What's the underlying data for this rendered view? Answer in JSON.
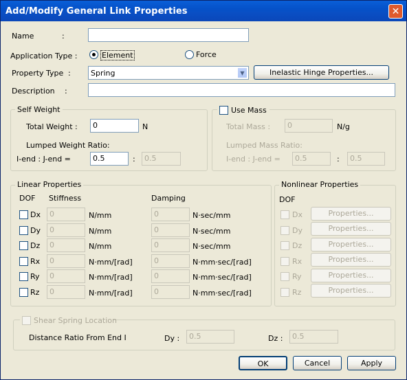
{
  "window": {
    "title": "Add/Modify General Link Properties",
    "close_label": "✕"
  },
  "general": {
    "name_label": "Name",
    "colon": ":",
    "name_value": "",
    "app_type_label": "Application Type :",
    "app_type_element": "Element",
    "app_type_force": "Force",
    "prop_type_label": "Property Type",
    "prop_type_value": "Spring",
    "inelastic_button": "Inelastic Hinge Properties...",
    "description_label": "Description",
    "description_value": ""
  },
  "self_weight": {
    "title": "Self Weight",
    "total_weight_label": "Total Weight :",
    "total_weight_value": "0",
    "total_weight_unit": "N",
    "lumped_label": "Lumped Weight Ratio:",
    "iend_label": "I-end : J-end =",
    "iend_value": "0.5",
    "sep": ":",
    "jend_value": "0.5"
  },
  "use_mass": {
    "title": "Use Mass",
    "total_mass_label": "Total Mass :",
    "total_mass_value": "0",
    "total_mass_unit": "N/g",
    "lumped_label": "Lumped Mass Ratio:",
    "iend_label": "I-end : J-end =",
    "iend_value": "0.5",
    "sep": ":",
    "jend_value": "0.5"
  },
  "linear": {
    "title": "Linear Properties",
    "dof_header": "DOF",
    "stiffness_header": "Stiffness",
    "damping_header": "Damping",
    "rows": [
      {
        "dof": "Dx",
        "stiffness": "0",
        "stiffness_unit": "N/mm",
        "damping": "0",
        "damping_unit": "N·sec/mm"
      },
      {
        "dof": "Dy",
        "stiffness": "0",
        "stiffness_unit": "N/mm",
        "damping": "0",
        "damping_unit": "N·sec/mm"
      },
      {
        "dof": "Dz",
        "stiffness": "0",
        "stiffness_unit": "N/mm",
        "damping": "0",
        "damping_unit": "N·sec/mm"
      },
      {
        "dof": "Rx",
        "stiffness": "0",
        "stiffness_unit": "N·mm/[rad]",
        "damping": "0",
        "damping_unit": "N·mm·sec/[rad]"
      },
      {
        "dof": "Ry",
        "stiffness": "0",
        "stiffness_unit": "N·mm/[rad]",
        "damping": "0",
        "damping_unit": "N·mm·sec/[rad]"
      },
      {
        "dof": "Rz",
        "stiffness": "0",
        "stiffness_unit": "N·mm/[rad]",
        "damping": "0",
        "damping_unit": "N·mm·sec/[rad]"
      }
    ]
  },
  "nonlinear": {
    "title": "Nonlinear Properties",
    "dof_header": "DOF",
    "rows": [
      {
        "dof": "Dx",
        "button": "Properties..."
      },
      {
        "dof": "Dy",
        "button": "Properties..."
      },
      {
        "dof": "Dz",
        "button": "Properties..."
      },
      {
        "dof": "Rx",
        "button": "Properties..."
      },
      {
        "dof": "Ry",
        "button": "Properties..."
      },
      {
        "dof": "Rz",
        "button": "Properties..."
      }
    ]
  },
  "shear": {
    "title": "Shear Spring Location",
    "distance_label": "Distance Ratio From End I",
    "dy_label": "Dy :",
    "dy_value": "0.5",
    "dz_label": "Dz :",
    "dz_value": "0.5"
  },
  "footer": {
    "ok": "OK",
    "cancel": "Cancel",
    "apply": "Apply"
  }
}
